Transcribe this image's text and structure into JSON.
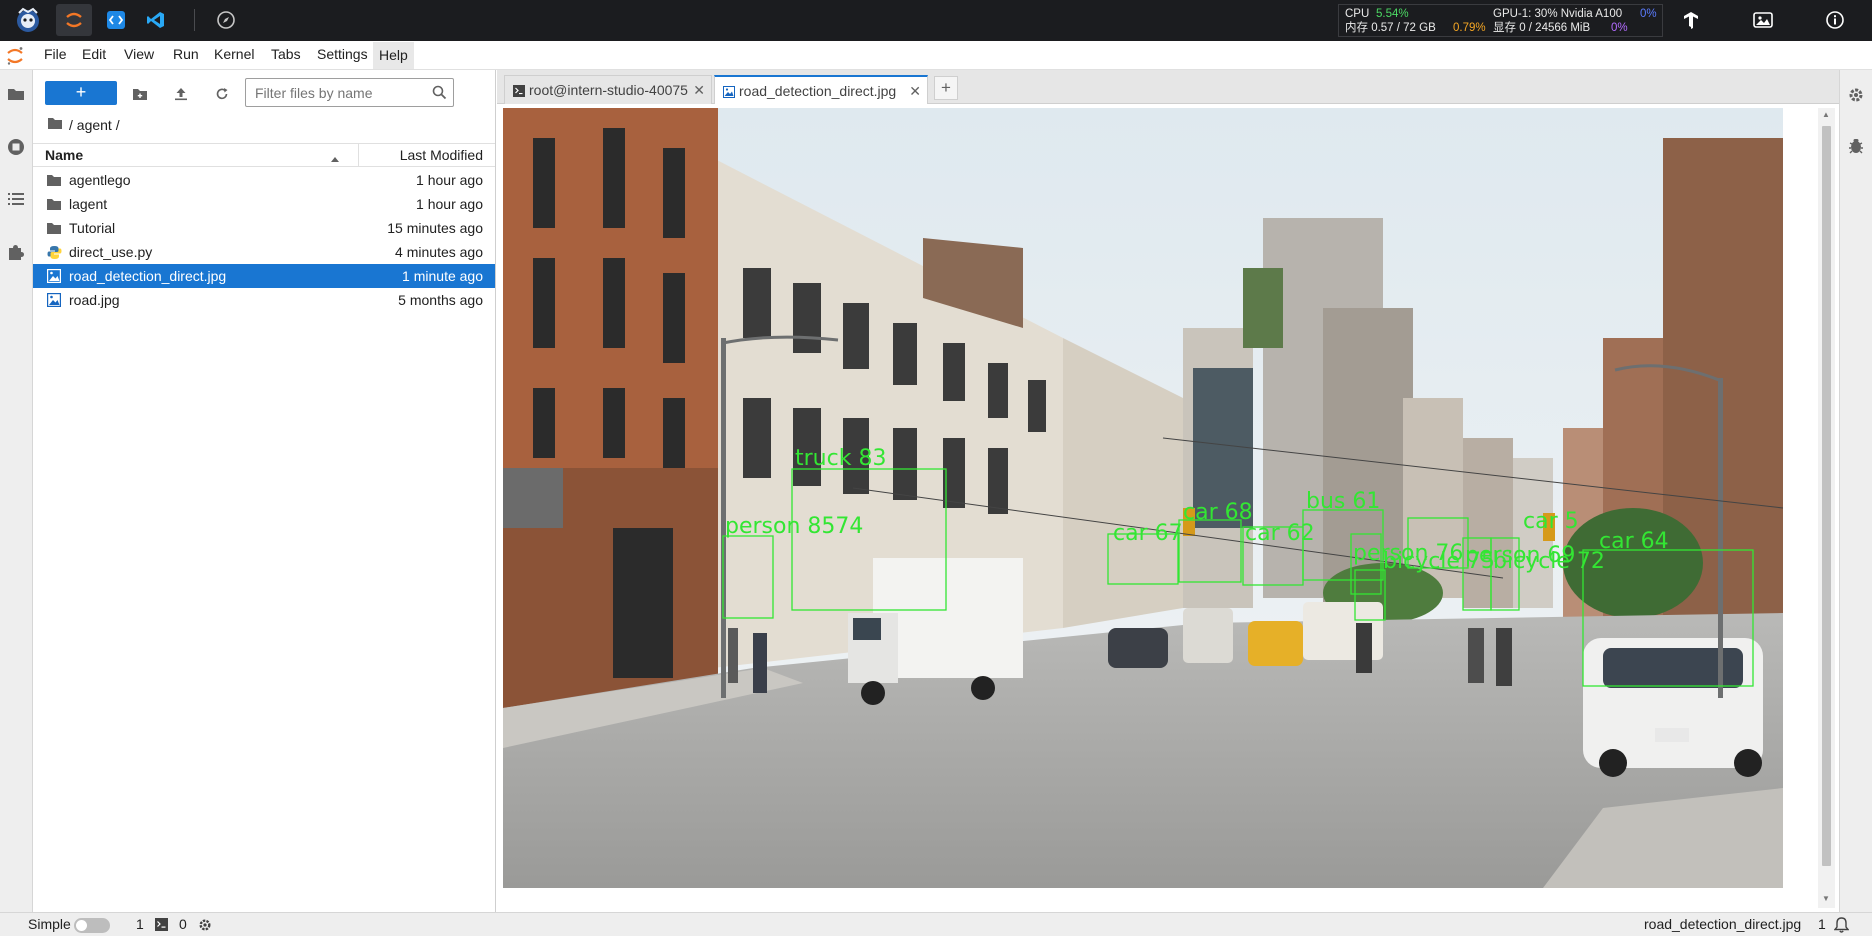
{
  "topbar": {
    "apps": [
      {
        "name": "intern-studio-logo-icon"
      },
      {
        "name": "jupyter-app-icon"
      },
      {
        "name": "code-app-icon"
      },
      {
        "name": "vscode-app-icon"
      },
      {
        "name": "compass-app-icon"
      }
    ],
    "stats": {
      "cpu_label": "CPU",
      "cpu_value": "5.54%",
      "gpu_label": "GPU-1: 30% Nvidia A100",
      "gpu_value": "0%",
      "mem_label": "内存 0.57 / 72 GB",
      "mem_value": "0.79%",
      "vram_label": "显存 0 / 24566 MiB",
      "vram_value": "0%"
    },
    "colors": {
      "green": "#4cd964",
      "orange": "#f5a623",
      "blue": "#5b7cff",
      "purple": "#b36bff"
    }
  },
  "menubar": {
    "items": [
      "File",
      "Edit",
      "View",
      "Run",
      "Kernel",
      "Tabs",
      "Settings",
      "Help"
    ]
  },
  "filebrowser": {
    "new_label": "+",
    "filter_placeholder": "Filter files by name",
    "breadcrumb": "/ agent /",
    "col_name": "Name",
    "col_modified": "Last Modified",
    "files": [
      {
        "name": "agentlego",
        "modified": "1 hour ago",
        "type": "folder",
        "selected": false
      },
      {
        "name": "lagent",
        "modified": "1 hour ago",
        "type": "folder",
        "selected": false
      },
      {
        "name": "Tutorial",
        "modified": "15 minutes ago",
        "type": "folder",
        "selected": false
      },
      {
        "name": "direct_use.py",
        "modified": "4 minutes ago",
        "type": "python",
        "selected": false
      },
      {
        "name": "road_detection_direct.jpg",
        "modified": "1 minute ago",
        "type": "image",
        "selected": true
      },
      {
        "name": "road.jpg",
        "modified": "5 months ago",
        "type": "image",
        "selected": false
      }
    ],
    "accent": "#1976d2"
  },
  "tabs": [
    {
      "label": "root@intern-studio-40075",
      "icon": "terminal-icon",
      "active": false
    },
    {
      "label": "road_detection_direct.jpg",
      "icon": "image-icon",
      "active": true
    }
  ],
  "detections": [
    {
      "label": "truck 83"
    },
    {
      "label": "person 8574"
    },
    {
      "label": "car 67"
    },
    {
      "label": "car 68"
    },
    {
      "label": "car 62"
    },
    {
      "label": "bus 61"
    },
    {
      "label": "person 76"
    },
    {
      "label": "bicycle 75"
    },
    {
      "label": "person 69"
    },
    {
      "label": "bicycle 72"
    },
    {
      "label": "car 64"
    },
    {
      "label": "car 5"
    }
  ],
  "statusbar": {
    "mode_label": "Simple",
    "terminals_count": "1",
    "kernels_count": "0",
    "current_file": "road_detection_direct.jpg",
    "notifications_count": "1"
  }
}
